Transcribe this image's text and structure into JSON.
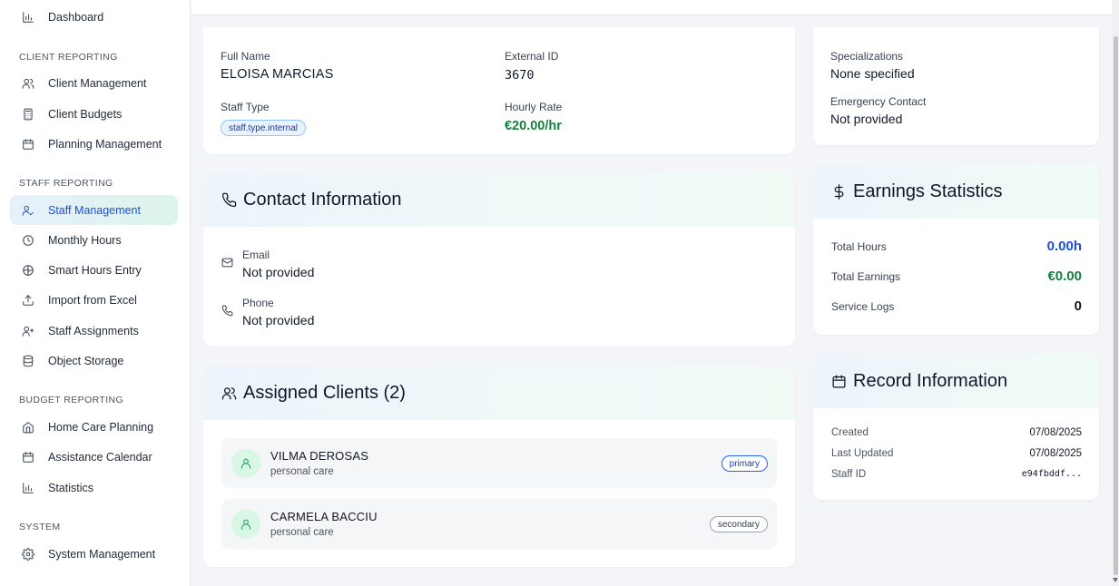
{
  "sidebar": {
    "top_item": "Dashboard",
    "sections": [
      {
        "title": "CLIENT REPORTING",
        "items": [
          "Client Management",
          "Client Budgets",
          "Planning Management"
        ]
      },
      {
        "title": "STAFF REPORTING",
        "items": [
          "Staff Management",
          "Monthly Hours",
          "Smart Hours Entry",
          "Import from Excel",
          "Staff Assignments",
          "Object Storage"
        ]
      },
      {
        "title": "BUDGET REPORTING",
        "items": [
          "Home Care Planning",
          "Assistance Calendar",
          "Statistics"
        ]
      },
      {
        "title": "SYSTEM",
        "items": [
          "System Management"
        ]
      }
    ],
    "active_item": "Staff Management"
  },
  "basic": {
    "full_name_label": "Full Name",
    "full_name": "ELOISA MARCIAS",
    "external_id_label": "External ID",
    "external_id": "3670",
    "staff_type_label": "Staff Type",
    "staff_type": "staff.type.internal",
    "hourly_rate_label": "Hourly Rate",
    "hourly_rate": "€20.00/hr"
  },
  "extra": {
    "specializations_label": "Specializations",
    "specializations": "None specified",
    "emergency_label": "Emergency Contact",
    "emergency": "Not provided"
  },
  "contact": {
    "title": "Contact Information",
    "email_label": "Email",
    "email": "Not provided",
    "phone_label": "Phone",
    "phone": "Not provided"
  },
  "clients": {
    "title": "Assigned Clients (2)",
    "items": [
      {
        "name": "VILMA DEROSAS",
        "service": "personal care",
        "role": "primary"
      },
      {
        "name": "CARMELA BACCIU",
        "service": "personal care",
        "role": "secondary"
      }
    ]
  },
  "earnings": {
    "title": "Earnings Statistics",
    "total_hours_label": "Total Hours",
    "total_hours": "0.00h",
    "total_earnings_label": "Total Earnings",
    "total_earnings": "€0.00",
    "service_logs_label": "Service Logs",
    "service_logs": "0"
  },
  "record": {
    "title": "Record Information",
    "created_label": "Created",
    "created": "07/08/2025",
    "updated_label": "Last Updated",
    "updated": "07/08/2025",
    "staff_id_label": "Staff ID",
    "staff_id": "e94fbddf..."
  },
  "colors": {
    "accent_blue": "#1d4ed8",
    "accent_green": "#15803d",
    "active_bg_start": "#e6f0fb",
    "active_bg_end": "#dcf5ea"
  }
}
